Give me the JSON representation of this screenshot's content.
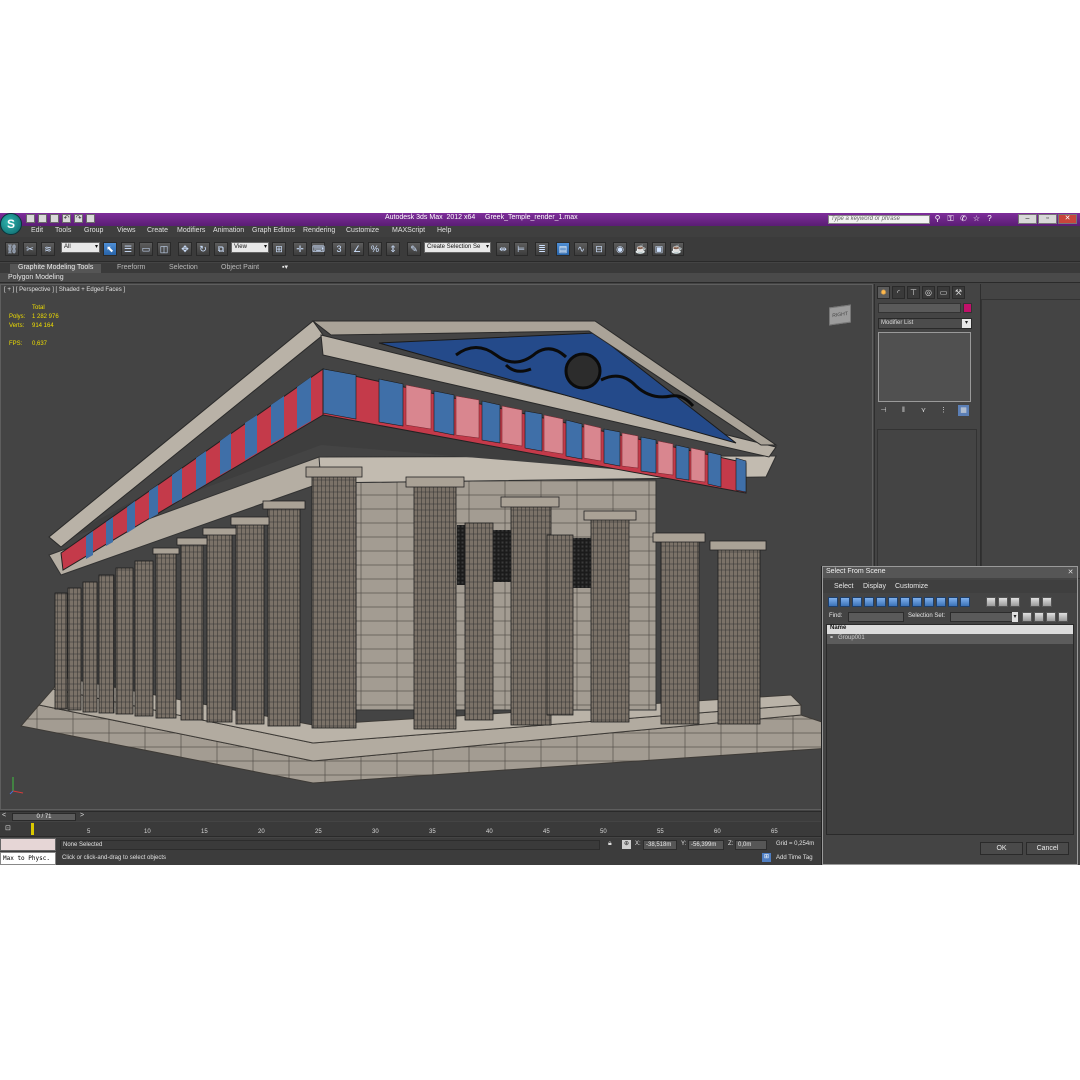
{
  "window": {
    "title": "Autodesk 3ds Max  2012 x64     Greek_Temple_render_1.max",
    "search_placeholder": "Type a keyword or phrase",
    "controls": [
      "–",
      "▫",
      "✕"
    ]
  },
  "menu": [
    "Edit",
    "Tools",
    "Group",
    "Views",
    "Create",
    "Modifiers",
    "Animation",
    "Graph Editors",
    "Rendering",
    "Customize",
    "MAXScript",
    "Help"
  ],
  "toolbar": {
    "selection_filter": "All",
    "reference_coord": "View",
    "named_selection_placeholder": "Create Selection Se"
  },
  "ribbon": {
    "tabs": [
      "Graphite Modeling Tools",
      "Freeform",
      "Selection",
      "Object Paint"
    ],
    "sub_label": "Polygon Modeling"
  },
  "viewport": {
    "label": "[ + ] [ Perspective ] [ Shaded + Edged Faces ]",
    "stats": {
      "header": "Total",
      "polys_label": "Polys:",
      "polys": "1 282 976",
      "verts_label": "Verts:",
      "verts": "914 164",
      "fps_label": "FPS:",
      "fps": "0,637"
    },
    "viewcube_label": "RIGHT"
  },
  "command_panel": {
    "modifier_list": "Modifier List",
    "object_color": "#c1116a"
  },
  "timeline": {
    "frame_display": "0 / 71",
    "ticks": [
      "5",
      "10",
      "15",
      "20",
      "25",
      "30",
      "35",
      "40",
      "45",
      "50",
      "55",
      "60",
      "65"
    ]
  },
  "status": {
    "maxscript": "Max to Physc.",
    "selection": "None Selected",
    "prompt": "Click or click-and-drag to select objects",
    "x_label": "X:",
    "x": "-38,518m",
    "y_label": "Y:",
    "y": "-56,399m",
    "z_label": "Z:",
    "z": "0,0m",
    "grid": "Grid = 0,254m",
    "add_time_tag": "Add Time Tag"
  },
  "dialog": {
    "title": "Select From Scene",
    "menu": [
      "Select",
      "Display",
      "Customize"
    ],
    "find_label": "Find:",
    "selection_set_label": "Selection Set:",
    "column_name": "Name",
    "items": [
      "Group001"
    ],
    "ok": "OK",
    "cancel": "Cancel"
  }
}
